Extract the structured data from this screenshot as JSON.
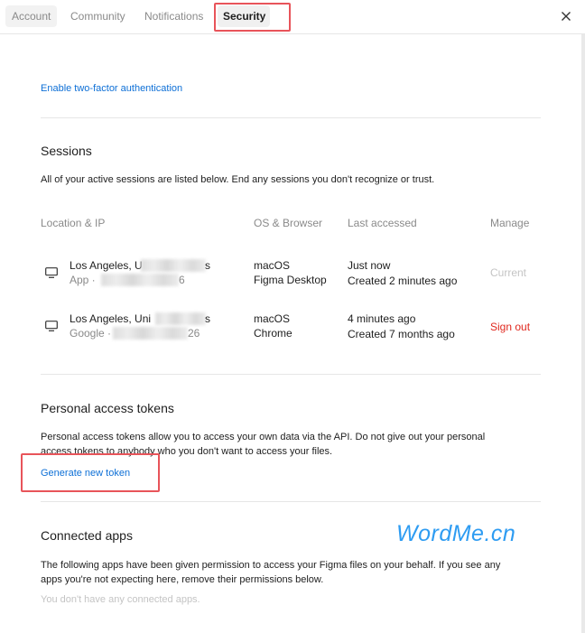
{
  "tabs": [
    {
      "label": "Account"
    },
    {
      "label": "Community"
    },
    {
      "label": "Notifications"
    },
    {
      "label": "Security",
      "active": true
    }
  ],
  "close_icon": "close-icon",
  "two_factor": {
    "link_label": "Enable two-factor authentication"
  },
  "sessions": {
    "title": "Sessions",
    "description": "All of your active sessions are listed below. End any sessions you don't recognize or trust.",
    "columns": [
      "Location & IP",
      "OS & Browser",
      "Last accessed",
      "Manage"
    ],
    "rows": [
      {
        "icon": "monitor-icon",
        "location": "Los Angeles, U",
        "location_tail": "s",
        "ip_prefix": "App ·",
        "ip_tail": "6",
        "os": "macOS",
        "browser": "Figma Desktop",
        "last_accessed": "Just now",
        "created": "Created 2 minutes ago",
        "action": "Current"
      },
      {
        "icon": "monitor-icon",
        "location": "Los Angeles, Uni",
        "location_tail": "s",
        "ip_prefix": "Google ·",
        "ip_tail": "26",
        "os": "macOS",
        "browser": "Chrome",
        "last_accessed": "4 minutes ago",
        "created": "Created 7 months ago",
        "action": "Sign out"
      }
    ]
  },
  "tokens": {
    "title": "Personal access tokens",
    "description_line1": "Personal access tokens allow you to access your own data via the API. Do not give out your personal",
    "description_line2": "access tokens to anybody who you don't want to access your files.",
    "generate_label": "Generate new token"
  },
  "connected_apps": {
    "title": "Connected apps",
    "description_line1": "The following apps have been given permission to access your Figma files on your behalf. If you see any",
    "description_line2": "apps you're not expecting here, remove their permissions below.",
    "empty_text": "You don't have any connected apps."
  },
  "watermark": "WordMe.cn",
  "colors": {
    "link": "#0d6fd6",
    "danger": "#e0281e",
    "highlight": "#e8545a",
    "muted": "#8a8a8a",
    "watermark": "#2e9cf2"
  }
}
